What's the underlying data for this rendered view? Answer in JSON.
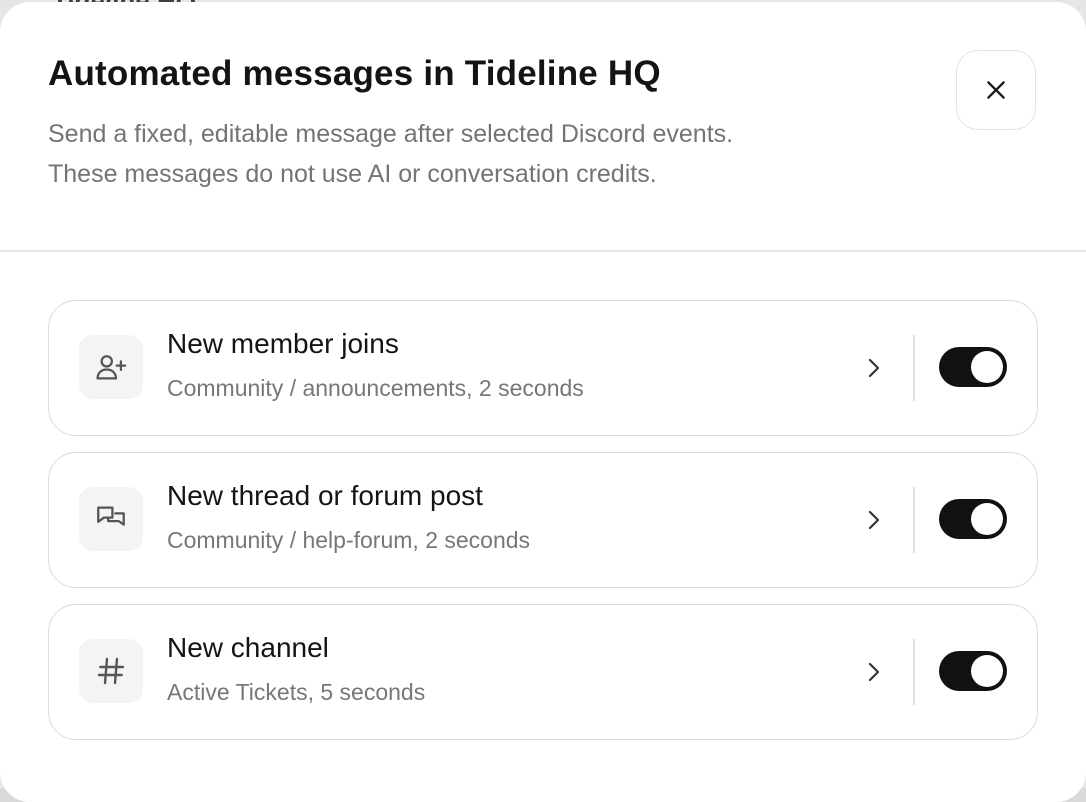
{
  "modal": {
    "title": "Automated messages in Tideline HQ",
    "description_lines": [
      "Send a fixed, editable message after selected Discord events.",
      "These messages do not use AI or conversation credits."
    ]
  },
  "backdrop": {
    "title_fragment": "Tideline HQ"
  },
  "automations": [
    {
      "title": "New member joins",
      "subtitle": "Community / announcements, 2 seconds",
      "icon": "user-plus-icon",
      "enabled": true
    },
    {
      "title": "New thread or forum post",
      "subtitle": "Community / help-forum, 2 seconds",
      "icon": "chat-bubbles-icon",
      "enabled": true
    },
    {
      "title": "New channel",
      "subtitle": "Active Tickets, 5 seconds",
      "icon": "hash-icon",
      "enabled": true
    }
  ],
  "colors": {
    "toggle_on": "#111111",
    "muted_text": "#777777",
    "border": "#dcdcdc"
  }
}
